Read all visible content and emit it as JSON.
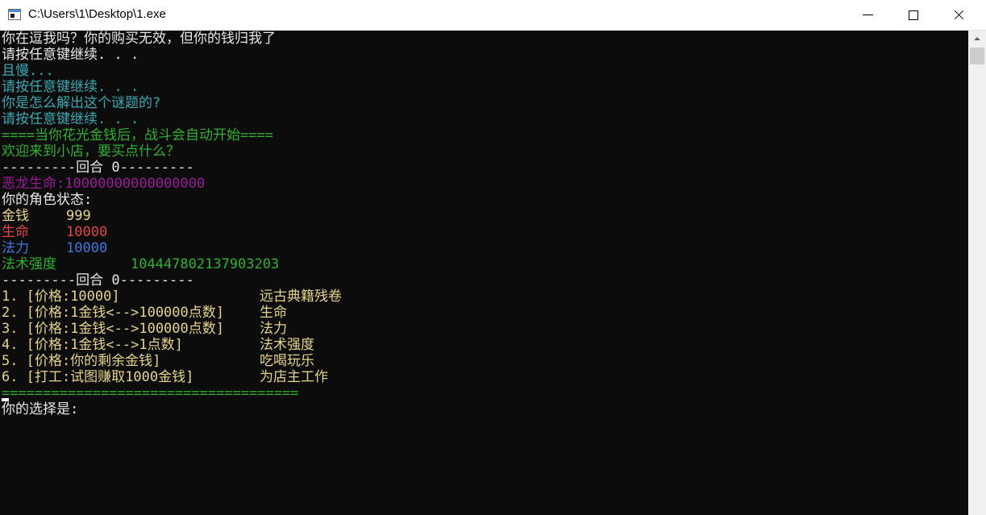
{
  "window": {
    "title": "C:\\Users\\1\\Desktop\\1.exe",
    "controls": {
      "minimize": "minimize",
      "maximize": "maximize",
      "close": "close"
    }
  },
  "colors": {
    "background": "#0c0c0c",
    "white": "#e8e8e8",
    "cyan": "#3aa9b3",
    "green": "#2fb12f",
    "purple": "#9a1c97",
    "yellow": "#e5d48a",
    "red": "#e04646",
    "blue": "#3f78e0"
  },
  "console": {
    "lines": [
      {
        "segments": [
          {
            "text": "你在逗我吗？你的购买无效，但你的钱归我了",
            "color": "white"
          }
        ]
      },
      {
        "segments": [
          {
            "text": "请按任意键继续. . .",
            "color": "white"
          }
        ]
      },
      {
        "segments": [
          {
            "text": "且慢...",
            "color": "cyan"
          }
        ]
      },
      {
        "segments": [
          {
            "text": "请按任意键继续. . .",
            "color": "cyan"
          }
        ]
      },
      {
        "segments": [
          {
            "text": "你是怎么解出这个谜题的?",
            "color": "cyan"
          }
        ]
      },
      {
        "segments": [
          {
            "text": "请按任意键继续. . .",
            "color": "cyan"
          }
        ]
      },
      {
        "segments": [
          {
            "text": "====当你花光金钱后，战斗会自动开始====",
            "color": "green"
          }
        ]
      },
      {
        "segments": [
          {
            "text": "欢迎来到小店，要买点什么？",
            "color": "green"
          }
        ]
      },
      {
        "segments": [
          {
            "text": "---------回合 0---------",
            "color": "white"
          }
        ]
      },
      {
        "segments": [
          {
            "text": "恶龙生命:10000000000000000",
            "color": "purple"
          }
        ]
      },
      {
        "segments": [
          {
            "text": "你的角色状态:",
            "color": "white"
          }
        ]
      },
      {
        "segments": [
          {
            "text": "金钱",
            "color": "yellow"
          },
          {
            "text": "999",
            "color": "yellow",
            "col": 80
          }
        ]
      },
      {
        "segments": [
          {
            "text": "生命",
            "color": "red"
          },
          {
            "text": "10000",
            "color": "red",
            "col": 80
          }
        ]
      },
      {
        "segments": [
          {
            "text": "法力",
            "color": "blue"
          },
          {
            "text": "10000",
            "color": "blue",
            "col": 80
          }
        ]
      },
      {
        "segments": [
          {
            "text": "法术强度",
            "color": "green"
          },
          {
            "text": "104447802137903203",
            "color": "green",
            "col": 160
          }
        ]
      },
      {
        "segments": [
          {
            "text": "---------回合 0---------",
            "color": "white"
          }
        ]
      },
      {
        "segments": [
          {
            "text": "1. [价格:10000]",
            "color": "yellow"
          },
          {
            "text": "远古典籍残卷",
            "color": "yellow",
            "col": 320
          }
        ]
      },
      {
        "segments": [
          {
            "text": "2. [价格:1金钱<-->100000点数]",
            "color": "yellow"
          },
          {
            "text": "生命",
            "color": "yellow",
            "col": 320
          }
        ]
      },
      {
        "segments": [
          {
            "text": "3. [价格:1金钱<-->100000点数]",
            "color": "yellow"
          },
          {
            "text": "法力",
            "color": "yellow",
            "col": 320
          }
        ]
      },
      {
        "segments": [
          {
            "text": "4. [价格:1金钱<-->1点数]",
            "color": "yellow"
          },
          {
            "text": "法术强度",
            "color": "yellow",
            "col": 320
          }
        ]
      },
      {
        "segments": [
          {
            "text": "5. [价格:你的剩余金钱]",
            "color": "yellow"
          },
          {
            "text": "吃喝玩乐",
            "color": "yellow",
            "col": 320
          }
        ]
      },
      {
        "segments": [
          {
            "text": "6. [打工:试图赚取1000金钱]",
            "color": "yellow"
          },
          {
            "text": "为店主工作",
            "color": "yellow",
            "col": 320
          }
        ]
      },
      {
        "segments": [
          {
            "text": "====================================",
            "color": "green"
          }
        ]
      },
      {
        "segments": [
          {
            "text": "你的选择是:",
            "color": "white"
          }
        ]
      }
    ]
  }
}
